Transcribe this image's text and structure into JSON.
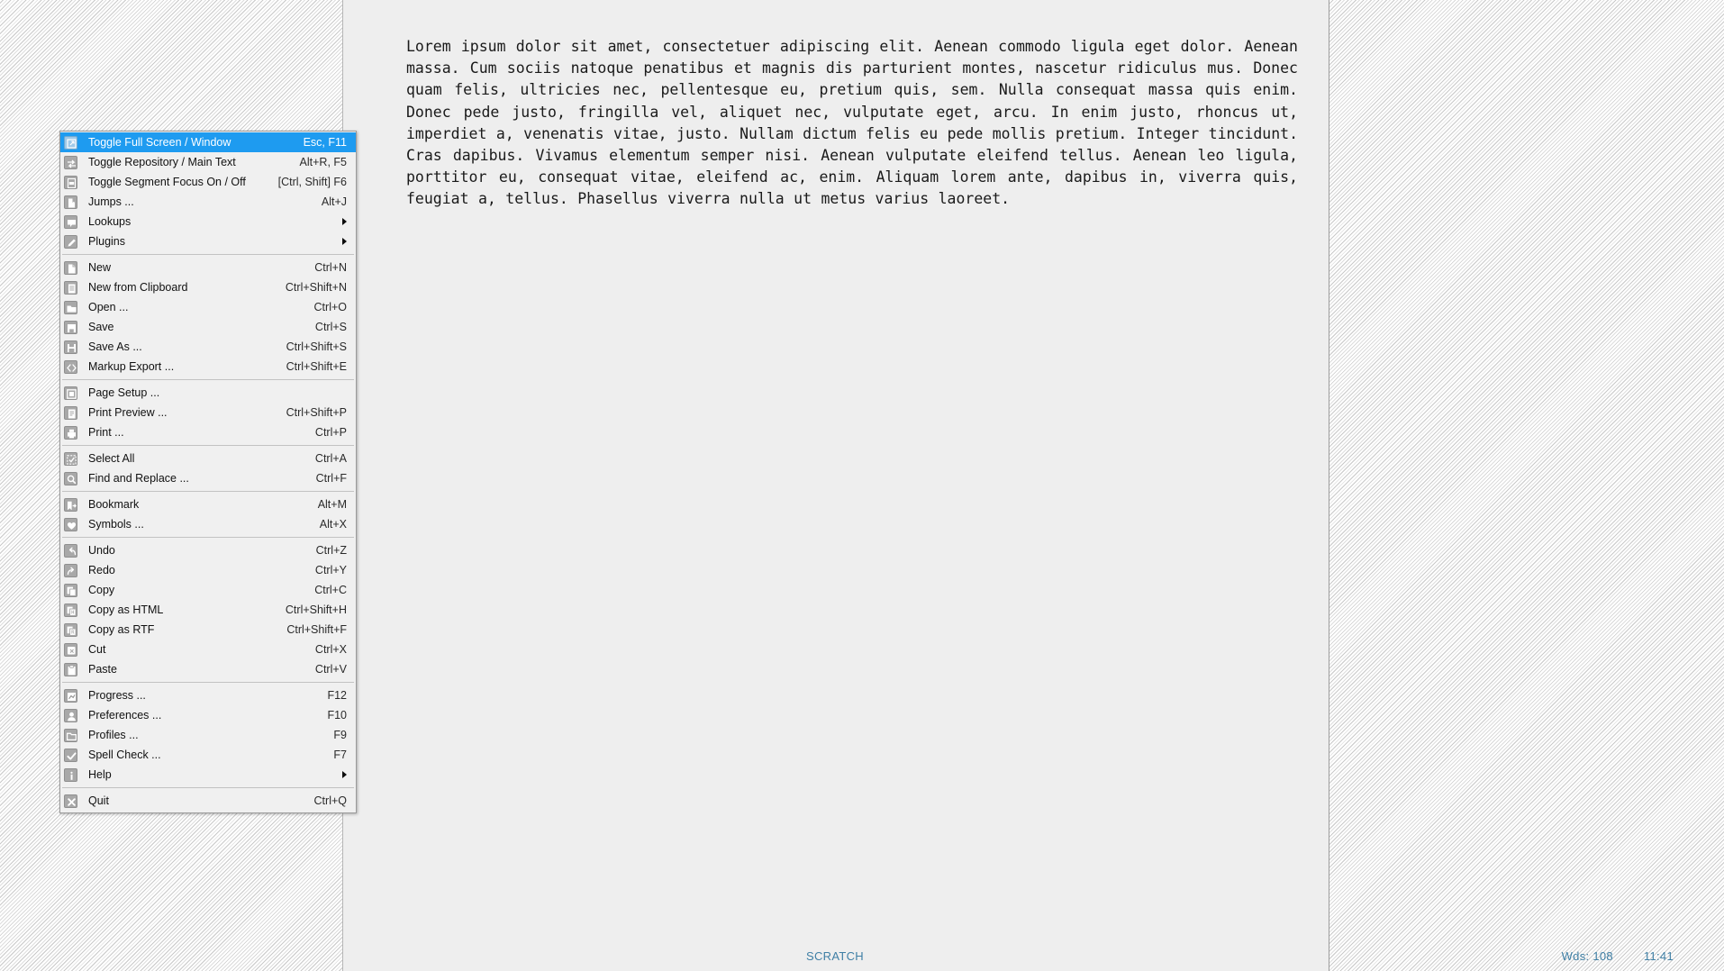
{
  "window": {
    "document_name": "SCRATCH",
    "word_count_label": "Wds: 108",
    "clock": "11:41",
    "accent_color": "#1e9bf0",
    "status_text_color": "#3f7fa5",
    "document_background": "#eeeeee"
  },
  "document": {
    "body": "Lorem ipsum dolor sit amet, consectetuer adipiscing elit. Aenean commodo ligula eget dolor. Aenean massa. Cum sociis natoque penatibus et magnis dis parturient montes, nascetur ridiculus mus. Donec quam felis, ultricies nec, pellentesque eu, pretium quis, sem. Nulla consequat massa quis enim. Donec pede justo, fringilla vel, aliquet nec, vulputate eget, arcu. In enim justo, rhoncus ut, imperdiet a, venenatis vitae, justo. Nullam dictum felis eu pede mollis pretium. Integer tincidunt. Cras dapibus. Vivamus elementum semper nisi. Aenean vulputate eleifend tellus. Aenean leo ligula, porttitor eu, consequat vitae, eleifend ac, enim. Aliquam lorem ante, dapibus in, viverra quis, feugiat a, tellus. Phasellus viverra nulla ut metus varius laoreet."
  },
  "context_menu": {
    "groups": [
      {
        "items": [
          {
            "label": "Toggle Full Screen / Window",
            "shortcut": "Esc, F11",
            "icon": "fullscreen-icon",
            "selected": true,
            "submenu": false
          },
          {
            "label": "Toggle Repository / Main Text",
            "shortcut": "Alt+R, F5",
            "icon": "swap-arrows-icon",
            "selected": false,
            "submenu": false
          },
          {
            "label": "Toggle Segment Focus On / Off",
            "shortcut": "[Ctrl, Shift] F6",
            "icon": "segment-focus-icon",
            "selected": false,
            "submenu": false
          },
          {
            "label": "Jumps ...",
            "shortcut": "Alt+J",
            "icon": "bookmark-page-icon",
            "selected": false,
            "submenu": false
          },
          {
            "label": "Lookups",
            "shortcut": "",
            "icon": "speech-bubble-icon",
            "selected": false,
            "submenu": true
          },
          {
            "label": "Plugins",
            "shortcut": "",
            "icon": "plug-pen-icon",
            "selected": false,
            "submenu": true
          }
        ]
      },
      {
        "items": [
          {
            "label": "New",
            "shortcut": "Ctrl+N",
            "icon": "new-document-icon",
            "selected": false,
            "submenu": false
          },
          {
            "label": "New from Clipboard",
            "shortcut": "Ctrl+Shift+N",
            "icon": "clipboard-document-icon",
            "selected": false,
            "submenu": false
          },
          {
            "label": "Open ...",
            "shortcut": "Ctrl+O",
            "icon": "open-folder-icon",
            "selected": false,
            "submenu": false
          },
          {
            "label": "Save",
            "shortcut": "Ctrl+S",
            "icon": "save-disk-icon",
            "selected": false,
            "submenu": false
          },
          {
            "label": "Save As ...",
            "shortcut": "Ctrl+Shift+S",
            "icon": "save-as-disk-icon",
            "selected": false,
            "submenu": false
          },
          {
            "label": "Markup Export ...",
            "shortcut": "Ctrl+Shift+E",
            "icon": "code-brackets-icon",
            "selected": false,
            "submenu": false
          }
        ]
      },
      {
        "items": [
          {
            "label": "Page Setup ...",
            "shortcut": "",
            "icon": "page-setup-icon",
            "selected": false,
            "submenu": false
          },
          {
            "label": "Print Preview ...",
            "shortcut": "Ctrl+Shift+P",
            "icon": "print-preview-icon",
            "selected": false,
            "submenu": false
          },
          {
            "label": "Print ...",
            "shortcut": "Ctrl+P",
            "icon": "printer-icon",
            "selected": false,
            "submenu": false
          }
        ]
      },
      {
        "items": [
          {
            "label": "Select All",
            "shortcut": "Ctrl+A",
            "icon": "select-all-icon",
            "selected": false,
            "submenu": false
          },
          {
            "label": "Find and Replace ...",
            "shortcut": "Ctrl+F",
            "icon": "magnifier-icon",
            "selected": false,
            "submenu": false
          }
        ]
      },
      {
        "items": [
          {
            "label": "Bookmark",
            "shortcut": "Alt+M",
            "icon": "bookmark-flag-icon",
            "selected": false,
            "submenu": false
          },
          {
            "label": "Symbols ...",
            "shortcut": "Alt+X",
            "icon": "symbols-heart-icon",
            "selected": false,
            "submenu": false
          }
        ]
      },
      {
        "items": [
          {
            "label": "Undo",
            "shortcut": "Ctrl+Z",
            "icon": "undo-arrow-icon",
            "selected": false,
            "submenu": false
          },
          {
            "label": "Redo",
            "shortcut": "Ctrl+Y",
            "icon": "redo-arrow-icon",
            "selected": false,
            "submenu": false
          },
          {
            "label": "Copy",
            "shortcut": "Ctrl+C",
            "icon": "copy-icon",
            "selected": false,
            "submenu": false
          },
          {
            "label": "Copy as HTML",
            "shortcut": "Ctrl+Shift+H",
            "icon": "copy-html-icon",
            "selected": false,
            "submenu": false
          },
          {
            "label": "Copy as RTF",
            "shortcut": "Ctrl+Shift+F",
            "icon": "copy-rtf-icon",
            "selected": false,
            "submenu": false
          },
          {
            "label": "Cut",
            "shortcut": "Ctrl+X",
            "icon": "cut-scissors-icon",
            "selected": false,
            "submenu": false
          },
          {
            "label": "Paste",
            "shortcut": "Ctrl+V",
            "icon": "paste-clipboard-icon",
            "selected": false,
            "submenu": false
          }
        ]
      },
      {
        "items": [
          {
            "label": "Progress ...",
            "shortcut": "F12",
            "icon": "progress-chart-icon",
            "selected": false,
            "submenu": false
          },
          {
            "label": "Preferences ...",
            "shortcut": "F10",
            "icon": "person-preferences-icon",
            "selected": false,
            "submenu": false
          },
          {
            "label": "Profiles ...",
            "shortcut": "F9",
            "icon": "profiles-folder-icon",
            "selected": false,
            "submenu": false
          },
          {
            "label": "Spell Check ...",
            "shortcut": "F7",
            "icon": "checkmark-icon",
            "selected": false,
            "submenu": false
          },
          {
            "label": "Help",
            "shortcut": "",
            "icon": "info-icon",
            "selected": false,
            "submenu": true
          }
        ]
      },
      {
        "items": [
          {
            "label": "Quit",
            "shortcut": "Ctrl+Q",
            "icon": "close-x-icon",
            "selected": false,
            "submenu": false
          }
        ]
      }
    ]
  }
}
